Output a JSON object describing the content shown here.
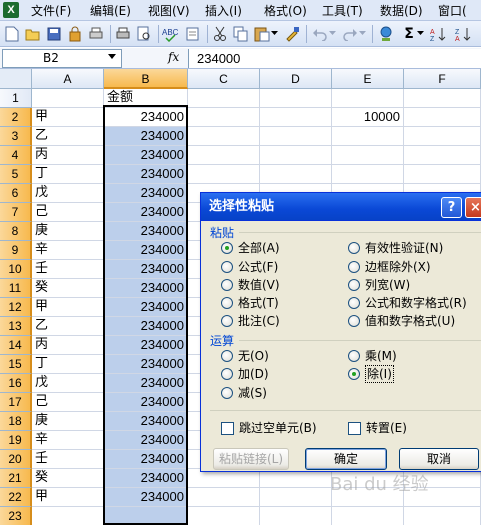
{
  "menu": {
    "items": [
      "文件(F)",
      "编辑(E)",
      "视图(V)",
      "插入(I)",
      "格式(O)",
      "工具(T)",
      "数据(D)",
      "窗口("
    ]
  },
  "toolbar": {
    "icons": [
      "new-icon",
      "open-icon",
      "save-icon",
      "permission-icon",
      "print-preview-icon",
      "print-icon",
      "preview-icon",
      "spelling-icon",
      "cut-icon",
      "copy-icon",
      "paste-icon",
      "format-painter-icon",
      "undo-icon",
      "redo-icon",
      "hyperlink-icon",
      "autosum-icon",
      "sort-icon"
    ]
  },
  "formula_bar": {
    "name_box": "B2",
    "fx": "fx",
    "value": "234000"
  },
  "sheet": {
    "columns": [
      "A",
      "B",
      "C",
      "D",
      "E",
      "F"
    ],
    "rows": [
      {
        "num": "1",
        "a": "",
        "b": "金额",
        "e": ""
      },
      {
        "num": "2",
        "a": "甲",
        "b": "234000",
        "e": "10000"
      },
      {
        "num": "3",
        "a": "乙",
        "b": "234000",
        "e": ""
      },
      {
        "num": "4",
        "a": "丙",
        "b": "234000",
        "e": ""
      },
      {
        "num": "5",
        "a": "丁",
        "b": "234000",
        "e": ""
      },
      {
        "num": "6",
        "a": "戊",
        "b": "234000",
        "e": ""
      },
      {
        "num": "7",
        "a": "己",
        "b": "234000",
        "e": ""
      },
      {
        "num": "8",
        "a": "庚",
        "b": "234000",
        "e": ""
      },
      {
        "num": "9",
        "a": "辛",
        "b": "234000",
        "e": ""
      },
      {
        "num": "10",
        "a": "壬",
        "b": "234000",
        "e": ""
      },
      {
        "num": "11",
        "a": "癸",
        "b": "234000",
        "e": ""
      },
      {
        "num": "12",
        "a": "甲",
        "b": "234000",
        "e": ""
      },
      {
        "num": "13",
        "a": "乙",
        "b": "234000",
        "e": ""
      },
      {
        "num": "14",
        "a": "丙",
        "b": "234000",
        "e": ""
      },
      {
        "num": "15",
        "a": "丁",
        "b": "234000",
        "e": ""
      },
      {
        "num": "16",
        "a": "戊",
        "b": "234000",
        "e": ""
      },
      {
        "num": "17",
        "a": "己",
        "b": "234000",
        "e": ""
      },
      {
        "num": "18",
        "a": "庚",
        "b": "234000",
        "e": ""
      },
      {
        "num": "19",
        "a": "辛",
        "b": "234000",
        "e": ""
      },
      {
        "num": "20",
        "a": "壬",
        "b": "234000",
        "e": ""
      },
      {
        "num": "21",
        "a": "癸",
        "b": "234000",
        "e": ""
      },
      {
        "num": "22",
        "a": "甲",
        "b": "234000",
        "e": ""
      },
      {
        "num": "23",
        "a": "",
        "b": "",
        "e": ""
      }
    ]
  },
  "dialog": {
    "title": "选择性粘贴",
    "help": "?",
    "close": "×",
    "paste_group": "粘贴",
    "paste_left": [
      "全部(A)",
      "公式(F)",
      "数值(V)",
      "格式(T)",
      "批注(C)"
    ],
    "paste_right": [
      "有效性验证(N)",
      "边框除外(X)",
      "列宽(W)",
      "公式和数字格式(R)",
      "值和数字格式(U)"
    ],
    "op_group": "运算",
    "op_left": [
      "无(O)",
      "加(D)",
      "减(S)"
    ],
    "op_right": [
      "乘(M)",
      "除(I)"
    ],
    "skip_blanks": "跳过空单元(B)",
    "transpose": "转置(E)",
    "paste_link": "粘贴链接(L)",
    "ok": "确定",
    "cancel": "取消"
  },
  "watermark": "Bai du 经验"
}
